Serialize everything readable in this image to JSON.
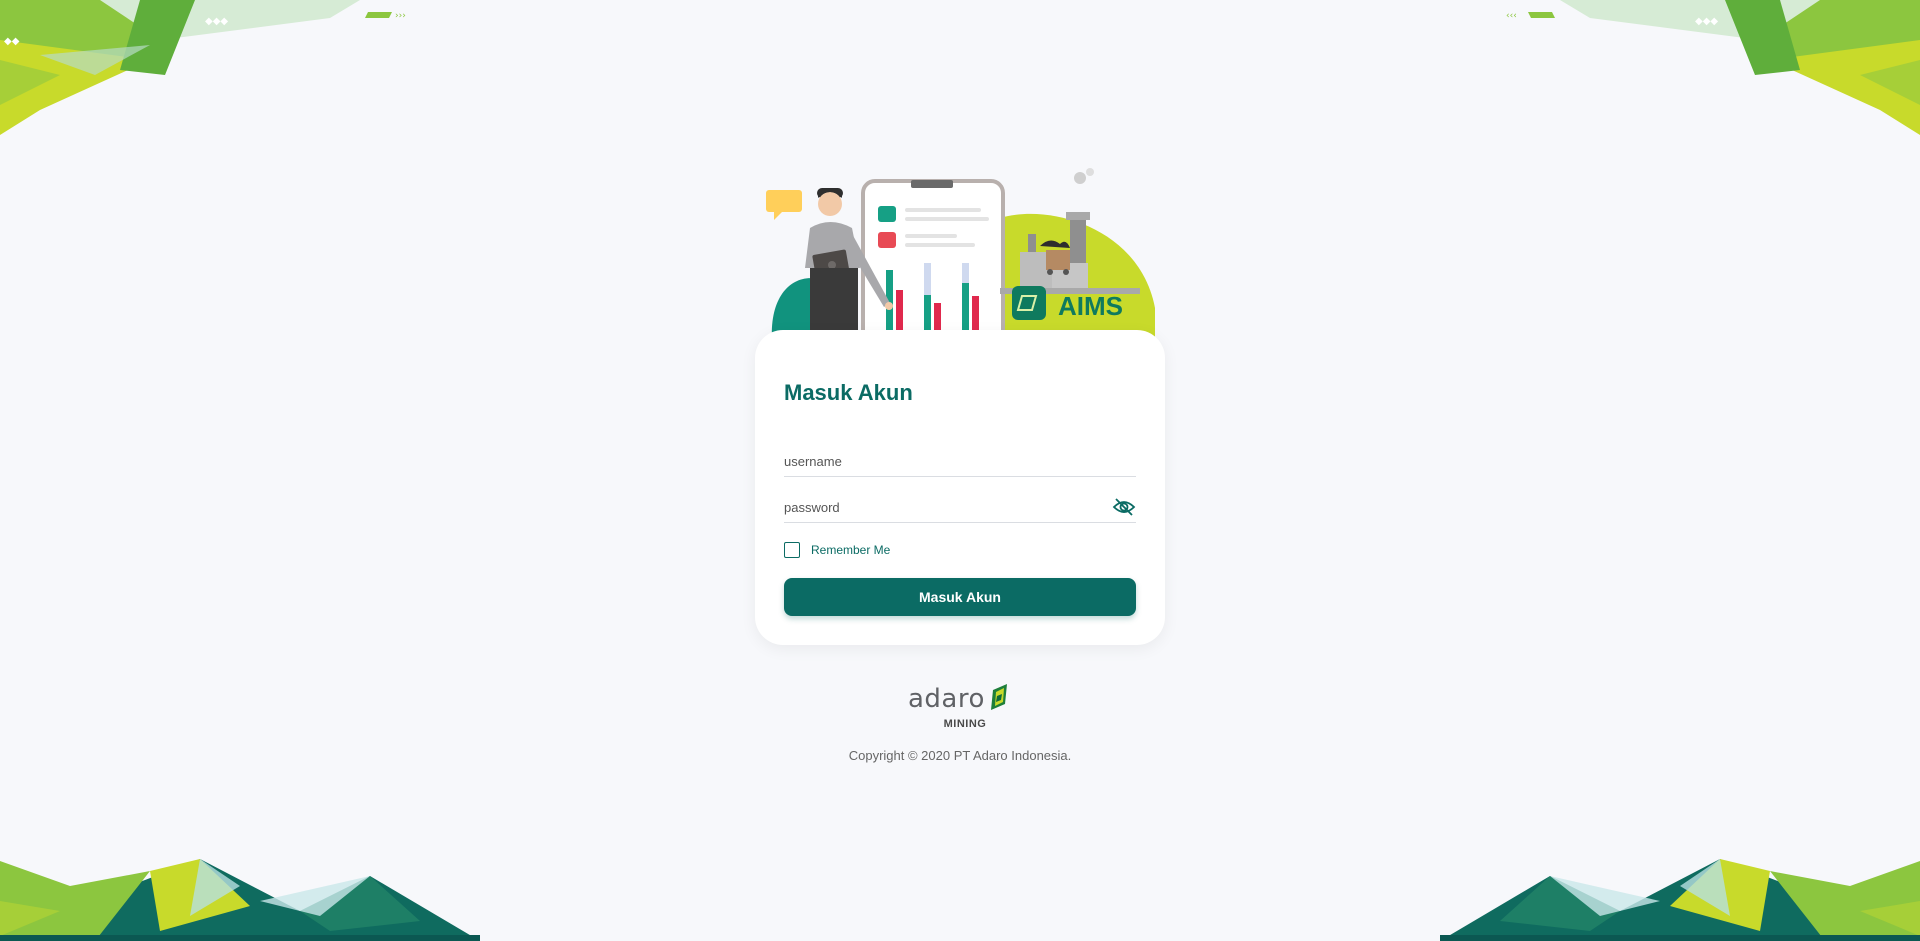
{
  "login": {
    "title": "Masuk Akun",
    "username_placeholder": "username",
    "password_placeholder": "password",
    "remember_label": "Remember Me",
    "submit_label": "Masuk Akun"
  },
  "hero": {
    "badge_text": "AIMS"
  },
  "brand": {
    "logo_text": "adaro",
    "logo_subtext": "MINING",
    "copyright": "Copyright © 2020 PT Adaro Indonesia."
  },
  "colors": {
    "primary": "#0b6b64",
    "accent_green": "#8cc63f",
    "accent_lime": "#c8da2b",
    "background": "#f7f8fb"
  },
  "icons": {
    "password_toggle": "eye-slash-icon"
  }
}
